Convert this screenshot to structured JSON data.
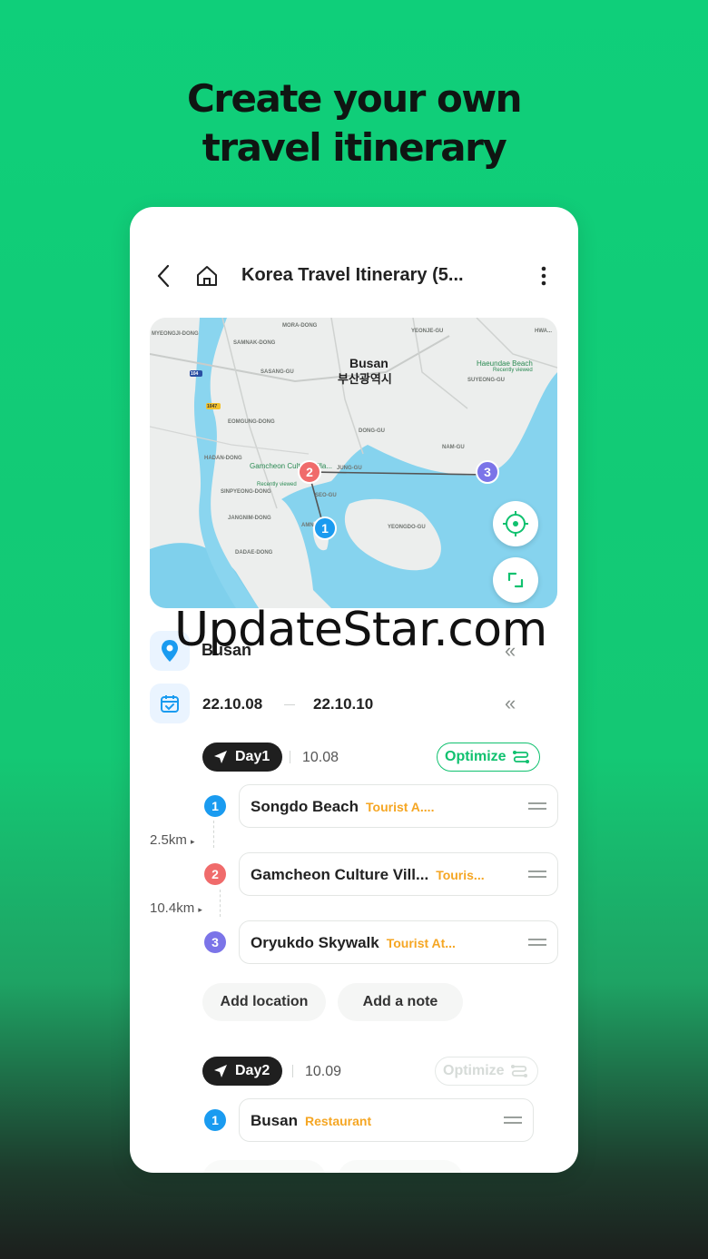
{
  "headline": {
    "line1": "Create your own",
    "line2": "travel itinerary"
  },
  "topbar": {
    "title": "Korea Travel Itinerary (5...",
    "back_icon": "chevron-left-icon",
    "home_icon": "home-icon",
    "more_icon": "more-vertical-icon"
  },
  "map": {
    "city_en": "Busan",
    "city_ko": "부산광역시",
    "labels": {
      "mora": "MORA-DONG",
      "samnak": "SAMNAK-DONG",
      "yeonje": "YEONJE-GU",
      "myeongji": "MYEONGJI-DONG",
      "sasang": "SASANG-GU",
      "haeundae": "Haeundae Beach",
      "recently1": "Recently viewed",
      "eomgung": "EOMGUNG-DONG",
      "hadan": "HADAN-DONG",
      "dong": "DONG-GU",
      "suyeong": "SUYEONG-GU",
      "gamcheon": "Gamcheon Culture Villa...",
      "recently2": "Recently viewed",
      "jung": "JUNG-GU",
      "namgu": "NAM-GU",
      "sinpyeong": "SINPYEONG-DONG",
      "seogu": "SEO-GU",
      "jangnim": "JANGNIM-DONG",
      "yeongdo": "YEONGDO-GU",
      "dadae": "DADAE-DONG",
      "amnam": "AMN...",
      "hwamyeong": "HWA...",
      "road104": "104",
      "road1047": "1047"
    },
    "markers": [
      "1",
      "2",
      "3"
    ],
    "locate_icon": "crosshair-icon",
    "expand_icon": "expand-icon"
  },
  "destination": {
    "label": "Busan",
    "icon": "location-pin-icon"
  },
  "dates": {
    "start": "22.10.08",
    "end": "22.10.10",
    "icon": "calendar-icon"
  },
  "watermark": "UpdateStar.com",
  "days": [
    {
      "label": "Day1",
      "date": "10.08",
      "optimize": "Optimize",
      "places": [
        {
          "num": "1",
          "name": "Songdo Beach",
          "category": "Tourist A...."
        },
        {
          "num": "2",
          "name": "Gamcheon Culture Vill...",
          "category": "Touris..."
        },
        {
          "num": "3",
          "name": "Oryukdo Skywalk",
          "category": "Tourist At..."
        }
      ],
      "distances": [
        "2.5km",
        "10.4km"
      ],
      "add_location": "Add location",
      "add_note": "Add a  note"
    },
    {
      "label": "Day2",
      "date": "10.09",
      "optimize": "Optimize",
      "places": [
        {
          "num": "1",
          "name": "Busan",
          "category": "Restaurant"
        }
      ]
    }
  ],
  "colors": {
    "accent": "#10c16f",
    "marker1": "#1a9bf0",
    "marker2": "#f06b6b",
    "marker3": "#7b74e8",
    "category": "#f5a623"
  }
}
